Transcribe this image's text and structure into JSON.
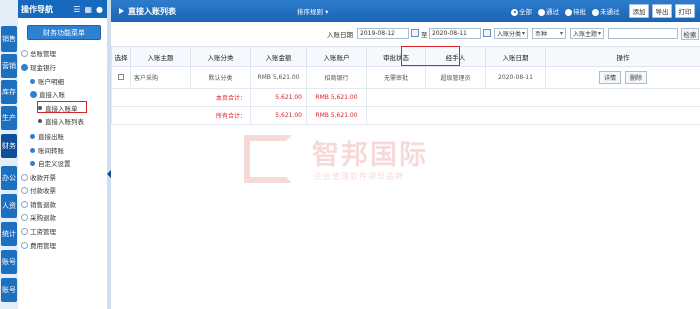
{
  "rail": {
    "tabs": [
      "销售",
      "营销",
      "库存",
      "生产",
      "财务",
      "办公",
      "人资",
      "统计",
      "账号",
      "账号"
    ]
  },
  "nav": {
    "title": "操作导航",
    "func_menu": "财务功能菜单",
    "tree": [
      {
        "label": "总账管理",
        "kind": "plus",
        "level": 0
      },
      {
        "label": "现金银行",
        "kind": "minus",
        "level": 0
      },
      {
        "label": "账户明细",
        "kind": "dot",
        "level": 1
      },
      {
        "label": "直接入账",
        "kind": "minus",
        "level": 1
      },
      {
        "label": "直接入账单",
        "kind": "bullet",
        "level": 2
      },
      {
        "label": "直接入账列表",
        "kind": "bullet",
        "level": 2
      },
      {
        "label": "直接出账",
        "kind": "dot",
        "level": 1
      },
      {
        "label": "账间转账",
        "kind": "dot",
        "level": 1
      },
      {
        "label": "自定义设置",
        "kind": "dot",
        "level": 1
      },
      {
        "label": "收款开票",
        "kind": "plus",
        "level": 0
      },
      {
        "label": "付款收票",
        "kind": "plus",
        "level": 0
      },
      {
        "label": "销售退款",
        "kind": "plus",
        "level": 0
      },
      {
        "label": "采购退款",
        "kind": "plus",
        "level": 0
      },
      {
        "label": "工资管理",
        "kind": "plus",
        "level": 0
      },
      {
        "label": "费用管理",
        "kind": "plus",
        "level": 0
      }
    ]
  },
  "header": {
    "title": "直接入账列表",
    "sort": "排序规则 ▾",
    "radios": [
      {
        "label": "全部",
        "on": true
      },
      {
        "label": "通过",
        "on": false
      },
      {
        "label": "待批",
        "on": false
      },
      {
        "label": "未通过",
        "on": false
      }
    ],
    "buttons": {
      "add": "添加",
      "export": "导出",
      "print": "打印"
    }
  },
  "filter": {
    "date_label": "入账日期",
    "date_from": "2019-08-12",
    "to_label": "至",
    "date_to": "2020-08-11",
    "category": "入账分类",
    "currency": "币种",
    "subject": "入账主题",
    "search_btn": "检索"
  },
  "table": {
    "headers": [
      "选择",
      "入账主题",
      "入账分类",
      "入账金额",
      "入账账户",
      "审批状态",
      "经手人",
      "入账日期",
      "操作"
    ],
    "rows": [
      {
        "subject": "客户采购",
        "category": "默认分类",
        "amount": "RMB 5,621.00",
        "account": "招商银行",
        "status": "无需审批",
        "handler": "超级管理员",
        "date": "2020-08-11",
        "op_detail": "详情",
        "op_delete": "删除"
      }
    ],
    "page_total_label": "本页合计：",
    "page_total_amount": "5,621.00",
    "page_total_rmb": "RMB 5,621.00",
    "all_total_label": "所有合计：",
    "all_total_amount": "5,621.00",
    "all_total_rmb": "RMB 5,621.00"
  },
  "watermark": {
    "title": "智邦国际",
    "subtitle": "企业管理软件领导品牌"
  }
}
